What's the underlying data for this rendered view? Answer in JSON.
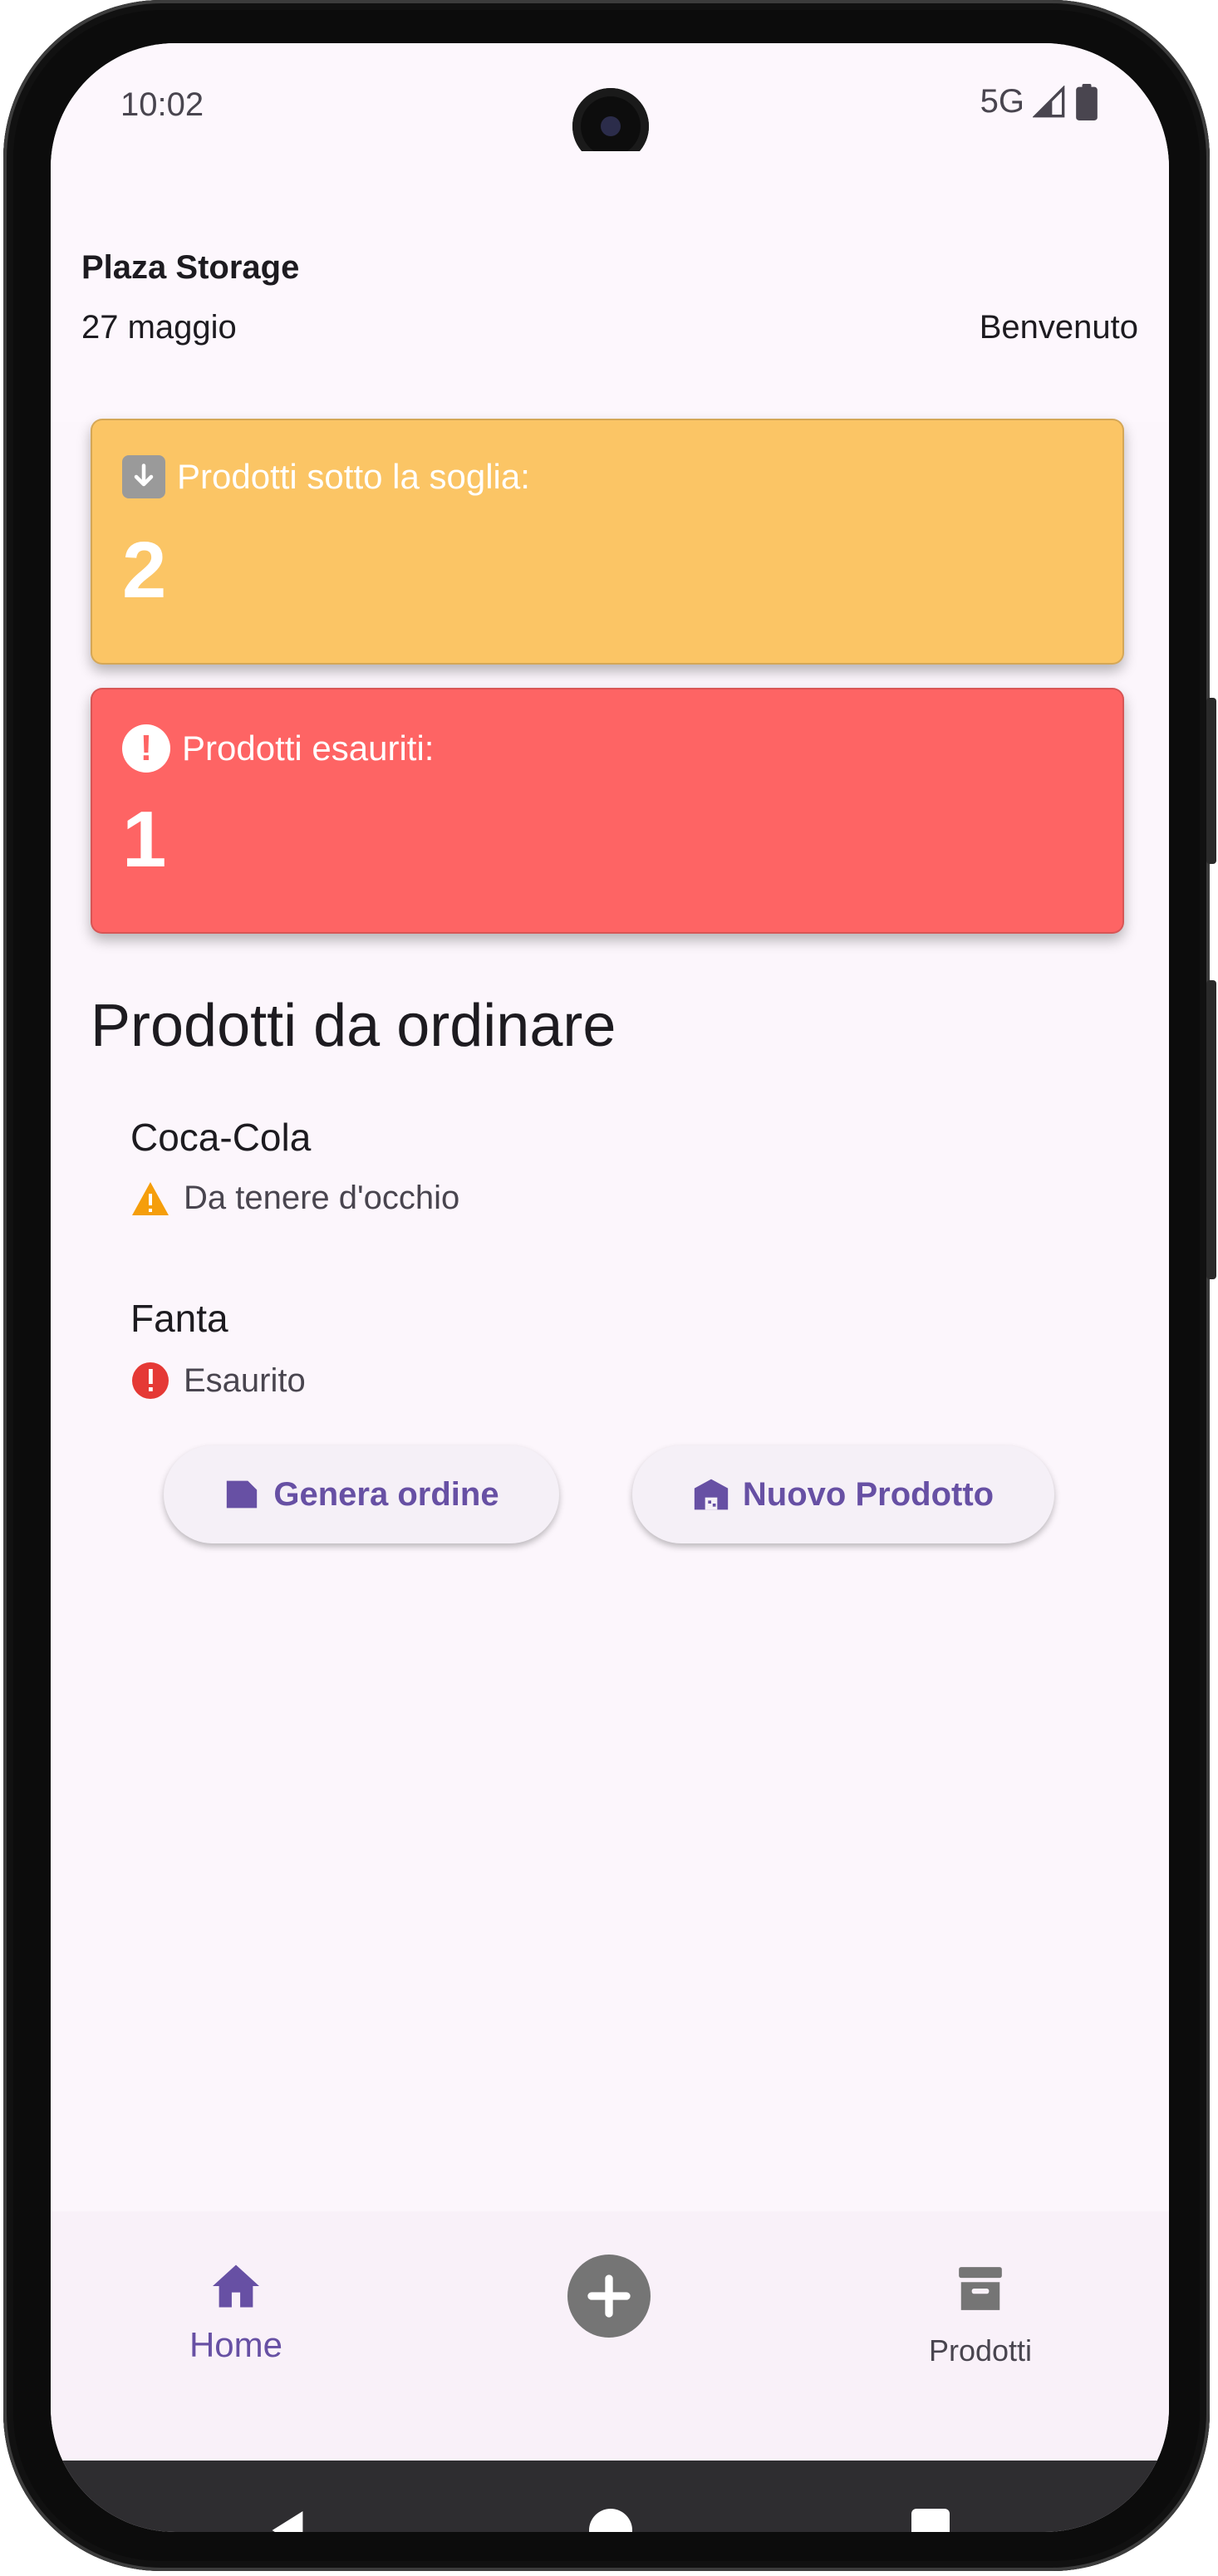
{
  "status_bar": {
    "time": "10:02",
    "network": "5G"
  },
  "header": {
    "app_name": "Plaza Storage",
    "date": "27 maggio",
    "welcome": "Benvenuto"
  },
  "cards": {
    "below_threshold": {
      "label": "Prodotti sotto la soglia:",
      "value": "2",
      "color": "#fbc565"
    },
    "out_of_stock": {
      "label": "Prodotti esauriti:",
      "value": "1",
      "color": "#fe6464"
    }
  },
  "section": {
    "title": "Prodotti da ordinare"
  },
  "items": [
    {
      "name": "Coca-Cola",
      "status": "Da tenere d'occhio",
      "icon": "warning-icon"
    },
    {
      "name": "Fanta",
      "status": "Esaurito",
      "icon": "error-icon"
    }
  ],
  "actions": {
    "generate_order": "Genera ordine",
    "new_product": "Nuovo Prodotto"
  },
  "navbar": {
    "home": "Home",
    "products": "Prodotti"
  },
  "colors": {
    "accent": "#6750a4",
    "warning": "#fbc565",
    "danger": "#fe6464"
  }
}
